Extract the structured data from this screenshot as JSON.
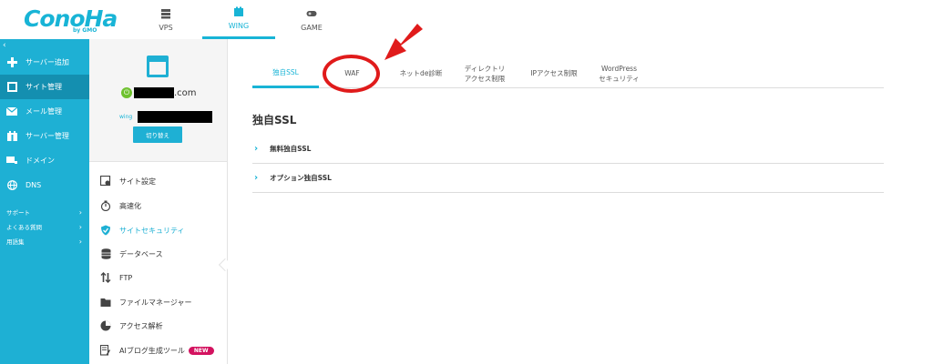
{
  "header": {
    "logo_text": "ConoHa",
    "logo_sub": "by GMO",
    "tabs": [
      {
        "label": "VPS",
        "icon": "server-icon"
      },
      {
        "label": "WING",
        "icon": "wing-icon",
        "active": true
      },
      {
        "label": "GAME",
        "icon": "gamepad-icon"
      }
    ]
  },
  "sidebar": {
    "collapse_icon": "chevron-left-icon",
    "items": [
      {
        "label": "サーバー追加",
        "icon": "plus-icon"
      },
      {
        "label": "サイト管理",
        "icon": "site-icon",
        "active": true
      },
      {
        "label": "メール管理",
        "icon": "mail-icon"
      },
      {
        "label": "サーバー管理",
        "icon": "server-icon"
      },
      {
        "label": "ドメイン",
        "icon": "domain-icon"
      },
      {
        "label": "DNS",
        "icon": "globe-icon"
      }
    ],
    "links": [
      {
        "label": "サポート"
      },
      {
        "label": "よくある質問"
      },
      {
        "label": "用語集"
      }
    ]
  },
  "panel": {
    "domain_suffix": ".com",
    "wing_label": "wing",
    "switch_button": "切り替え",
    "items": [
      {
        "label": "サイト設定",
        "icon": "site-settings-icon"
      },
      {
        "label": "高速化",
        "icon": "stopwatch-icon"
      },
      {
        "label": "サイトセキュリティ",
        "icon": "shield-icon",
        "active": true
      },
      {
        "label": "データベース",
        "icon": "database-icon"
      },
      {
        "label": "FTP",
        "icon": "transfer-icon"
      },
      {
        "label": "ファイルマネージャー",
        "icon": "folder-icon"
      },
      {
        "label": "アクセス解析",
        "icon": "pie-chart-icon"
      },
      {
        "label": "AIブログ生成ツール",
        "icon": "edit-icon",
        "badge": "NEW"
      }
    ]
  },
  "main": {
    "tabs": [
      {
        "label": "独自SSL",
        "active": true
      },
      {
        "label": "WAF"
      },
      {
        "label": "ネットde診断"
      },
      {
        "line1": "ディレクトリ",
        "line2": "アクセス制限"
      },
      {
        "label": "IPアクセス制限"
      },
      {
        "line1": "WordPress",
        "line2": "セキュリティ"
      }
    ],
    "title": "独自SSL",
    "sections": [
      {
        "label": "無料独自SSL"
      },
      {
        "label": "オプション独自SSL"
      }
    ]
  },
  "colors": {
    "brand": "#1eb0d4",
    "active_nav": "#148fb0",
    "annotation": "#e01b1b",
    "new_badge": "#d3125f"
  }
}
